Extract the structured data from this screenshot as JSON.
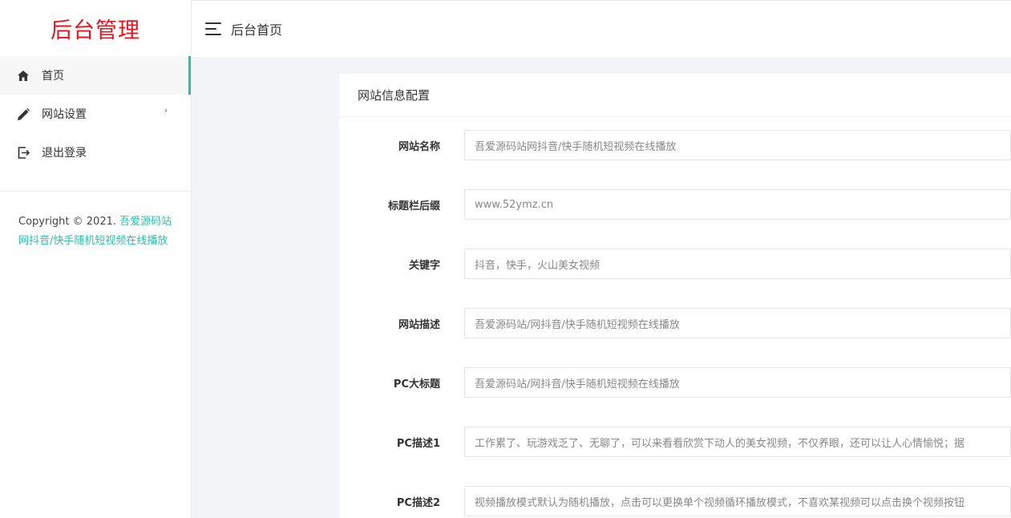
{
  "sidebar": {
    "brand": "后台管理",
    "items": [
      {
        "label": "首页",
        "icon": "home-icon"
      },
      {
        "label": "网站设置",
        "icon": "pencil-icon",
        "chevron": "›"
      },
      {
        "label": "退出登录",
        "icon": "logout-icon"
      }
    ],
    "copyright_prefix": "Copyright © 2021.",
    "copyright_link": "吾爱源码站网抖音/快手随机短视频在线播放"
  },
  "topbar": {
    "title": "后台首页"
  },
  "card": {
    "title": "网站信息配置",
    "fields": [
      {
        "label": "网站名称",
        "value": "吾爱源码站网抖音/快手随机短视频在线播放"
      },
      {
        "label": "标题栏后缀",
        "value": "www.52ymz.cn"
      },
      {
        "label": "关键字",
        "value": "抖音，快手，火山美女视频"
      },
      {
        "label": "网站描述",
        "value": "吾爱源码站/网抖音/快手随机短视频在线播放"
      },
      {
        "label": "PC大标题",
        "value": "吾爱源码站/网抖音/快手随机短视频在线播放"
      },
      {
        "label": "PC描述1",
        "value": "工作累了、玩游戏乏了、无聊了，可以来看看欣赏下动人的美女视频，不仅养眼，还可以让人心情愉悦；据"
      },
      {
        "label": "PC描述2",
        "value": "视频播放模式默认为随机播放，点击可以更换单个视频循环播放模式，不喜欢某视频可以点击换个视频按钮"
      }
    ]
  },
  "colors": {
    "brand_red": "#e8141f",
    "accent_teal": "#29c0a6"
  }
}
